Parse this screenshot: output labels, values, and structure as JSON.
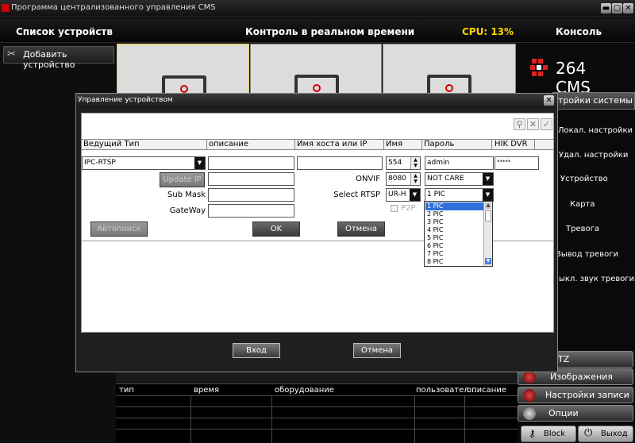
{
  "window": {
    "title": "Программа централизованного управления  CMS",
    "min": "▬",
    "max": "▢",
    "close": "✕"
  },
  "header": {
    "devices": "Список устройств",
    "realtime": "Контроль в реальном времени",
    "cpu": "CPU: 13%",
    "console": "Консоль"
  },
  "left": {
    "add_device": "Добавить устройство"
  },
  "brand": {
    "logo_text": "264 CMS"
  },
  "right_menu": {
    "system_settings": "тройки системы",
    "items": [
      "Локал. настройки",
      "Удал. настройки",
      "Устройство",
      "Карта",
      "Тревога",
      "Вывод тревоги",
      "ыкл. звук тревоги"
    ],
    "ptz": "TZ",
    "images": "Изображения",
    "record_settings": "Настройки записи",
    "options": "Опции",
    "block": "Block",
    "exit": "Выход"
  },
  "events": {
    "headers": [
      "тип",
      "время",
      "оборудование",
      "пользовател...",
      "описание"
    ]
  },
  "dialog": {
    "title": "Управление устройством",
    "close": "✕",
    "columns": [
      "Ведущий Тип",
      "описание",
      "Имя хоста или IP",
      "Имя",
      "Пароль",
      "HIK DVR"
    ],
    "type_value": "IPC-RTSP",
    "description_value": "",
    "host_value": "",
    "port_value": "554",
    "user_value": "admin",
    "password_value": "*****",
    "update_ip": "Update IP",
    "submask_label": "Sub Mask",
    "gateway_label": "GateWay",
    "onvif_label": "ONVIF",
    "onvif_port": "8080",
    "notcare": "NOT CARE",
    "select_rtsp_label": "Select RTSP",
    "rtsp_value": "UR-H",
    "pic_value": "1 PIC",
    "p2p_label": "P2P",
    "autosearch": "Автопоиск",
    "ok": "OK",
    "cancel": "Отмена",
    "pic_options": [
      "1 PIC",
      "2 PIC",
      "3 PIC",
      "4 PIC",
      "5 PIC",
      "6 PIC",
      "7 PIC",
      "8 PIC"
    ],
    "login": "Вход",
    "cancel_bottom": "Отмена"
  }
}
